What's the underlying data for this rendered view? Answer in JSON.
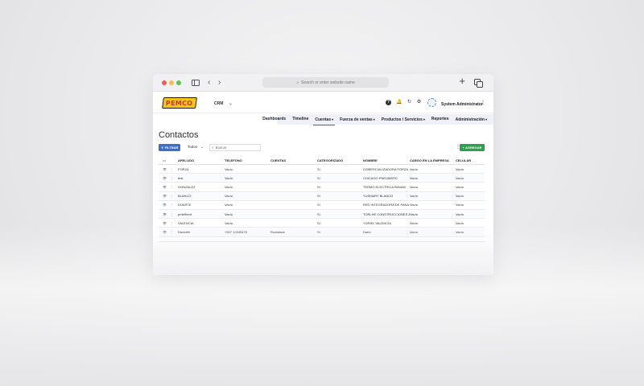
{
  "browser": {
    "url_placeholder": "Search or enter website name",
    "plus_glyph": "+",
    "back_glyph": "‹",
    "forward_glyph": "›",
    "search_glyph": "⌕"
  },
  "app": {
    "logo_text": "PEMCO",
    "module": "CRM",
    "module_caret": "⌄",
    "user_name": "System Administrator",
    "icons": {
      "help": "?",
      "bell": "🔔",
      "refresh": "↻",
      "gear": "⚙",
      "kebab": "⋮"
    }
  },
  "nav": {
    "items": [
      {
        "label": "Dashboards",
        "caret": ""
      },
      {
        "label": "Timeline",
        "caret": ""
      },
      {
        "label": "Cuentas",
        "caret": "▾"
      },
      {
        "label": "Fuerza de ventas",
        "caret": "▾"
      },
      {
        "label": "Productos / Servicios",
        "caret": "▾"
      },
      {
        "label": "Reportes",
        "caret": ""
      },
      {
        "label": "Administración",
        "caret": "▾"
      }
    ],
    "active_index": 2,
    "accent_color": "#d32f2f"
  },
  "page": {
    "title": "Contactos",
    "filter_label": "FILTRAR",
    "filter_glyph": "▼",
    "scope_value": "Todos",
    "scope_caret": "⌄",
    "search_placeholder": "Buscar",
    "more_glyph": "⋮",
    "add_label": "AGREGAR",
    "add_glyph": "+",
    "filter_color": "#3d6fc9",
    "add_color": "#2e9e4f"
  },
  "table": {
    "columns": {
      "actions": "•••",
      "apellido": "APELLIDO",
      "telefono": "TELEFONO",
      "cuentas": "CUENTAS",
      "categorizado": "CATEGORIZADO",
      "nombre": "NOMBRE",
      "cargo": "CARGO EN LA EMPRESA",
      "celular": "CELULAR"
    },
    "rows": [
      {
        "view": "👁",
        "menu": "⋮",
        "apellido": "FORZA",
        "telefono": "Vacío",
        "cuentas": "",
        "categorizado": "Sí",
        "nombre": "COMERCIALIZADORA FORZA...",
        "cargo": "Vacío",
        "celular": "Vacío"
      },
      {
        "view": "👁",
        "menu": "⋮",
        "apellido": "test",
        "telefono": "Vacío",
        "cuentas": "",
        "categorizado": "Sí",
        "nombre": "CHICAGO PNEUMATIC",
        "cargo": "Vacío",
        "celular": "Vacío"
      },
      {
        "view": "👁",
        "menu": "⋮",
        "apellido": "GONZALEZ",
        "telefono": "Vacío",
        "cuentas": "",
        "categorizado": "Sí",
        "nombre": "TERMO ELECTRICA PANAM",
        "cargo": "Vacío",
        "celular": "Vacío"
      },
      {
        "view": "👁",
        "menu": "⋮",
        "apellido": "BLANCO",
        "telefono": "Vacío",
        "cuentas": "",
        "categorizado": "Sí",
        "nombre": "YUSMARY BLANCO",
        "cargo": "Vacío",
        "celular": "Vacío"
      },
      {
        "view": "👁",
        "menu": "⋮",
        "apellido": "DUARTE",
        "telefono": "Vacío",
        "cuentas": "",
        "categorizado": "Sí",
        "nombre": "RED INTEGRADORA DE PANA...",
        "cargo": "Vacío",
        "celular": "Vacío"
      },
      {
        "view": "👁",
        "menu": "⋮",
        "apellido": "prdefhent",
        "telefono": "Vacío",
        "cuentas": "",
        "categorizado": "Sí",
        "nombre": "TORLHE CONSTRUCCIONES & ...",
        "cargo": "Vacío",
        "celular": "Vacío"
      },
      {
        "view": "👁",
        "menu": "⋮",
        "apellido": "VALENCIA",
        "telefono": "Vacío",
        "cuentas": "",
        "categorizado": "Sí",
        "nombre": "YURIEL VALENCIA",
        "cargo": "Vacío",
        "celular": "Vacío"
      },
      {
        "view": "👁",
        "menu": "⋮",
        "apellido": "Davicirlh",
        "telefono": "+507 12345475",
        "cuentas": "Rootstack",
        "categorizado": "Sí",
        "nombre": "Dario",
        "cargo": "Vacío",
        "celular": "Vacío"
      }
    ]
  }
}
